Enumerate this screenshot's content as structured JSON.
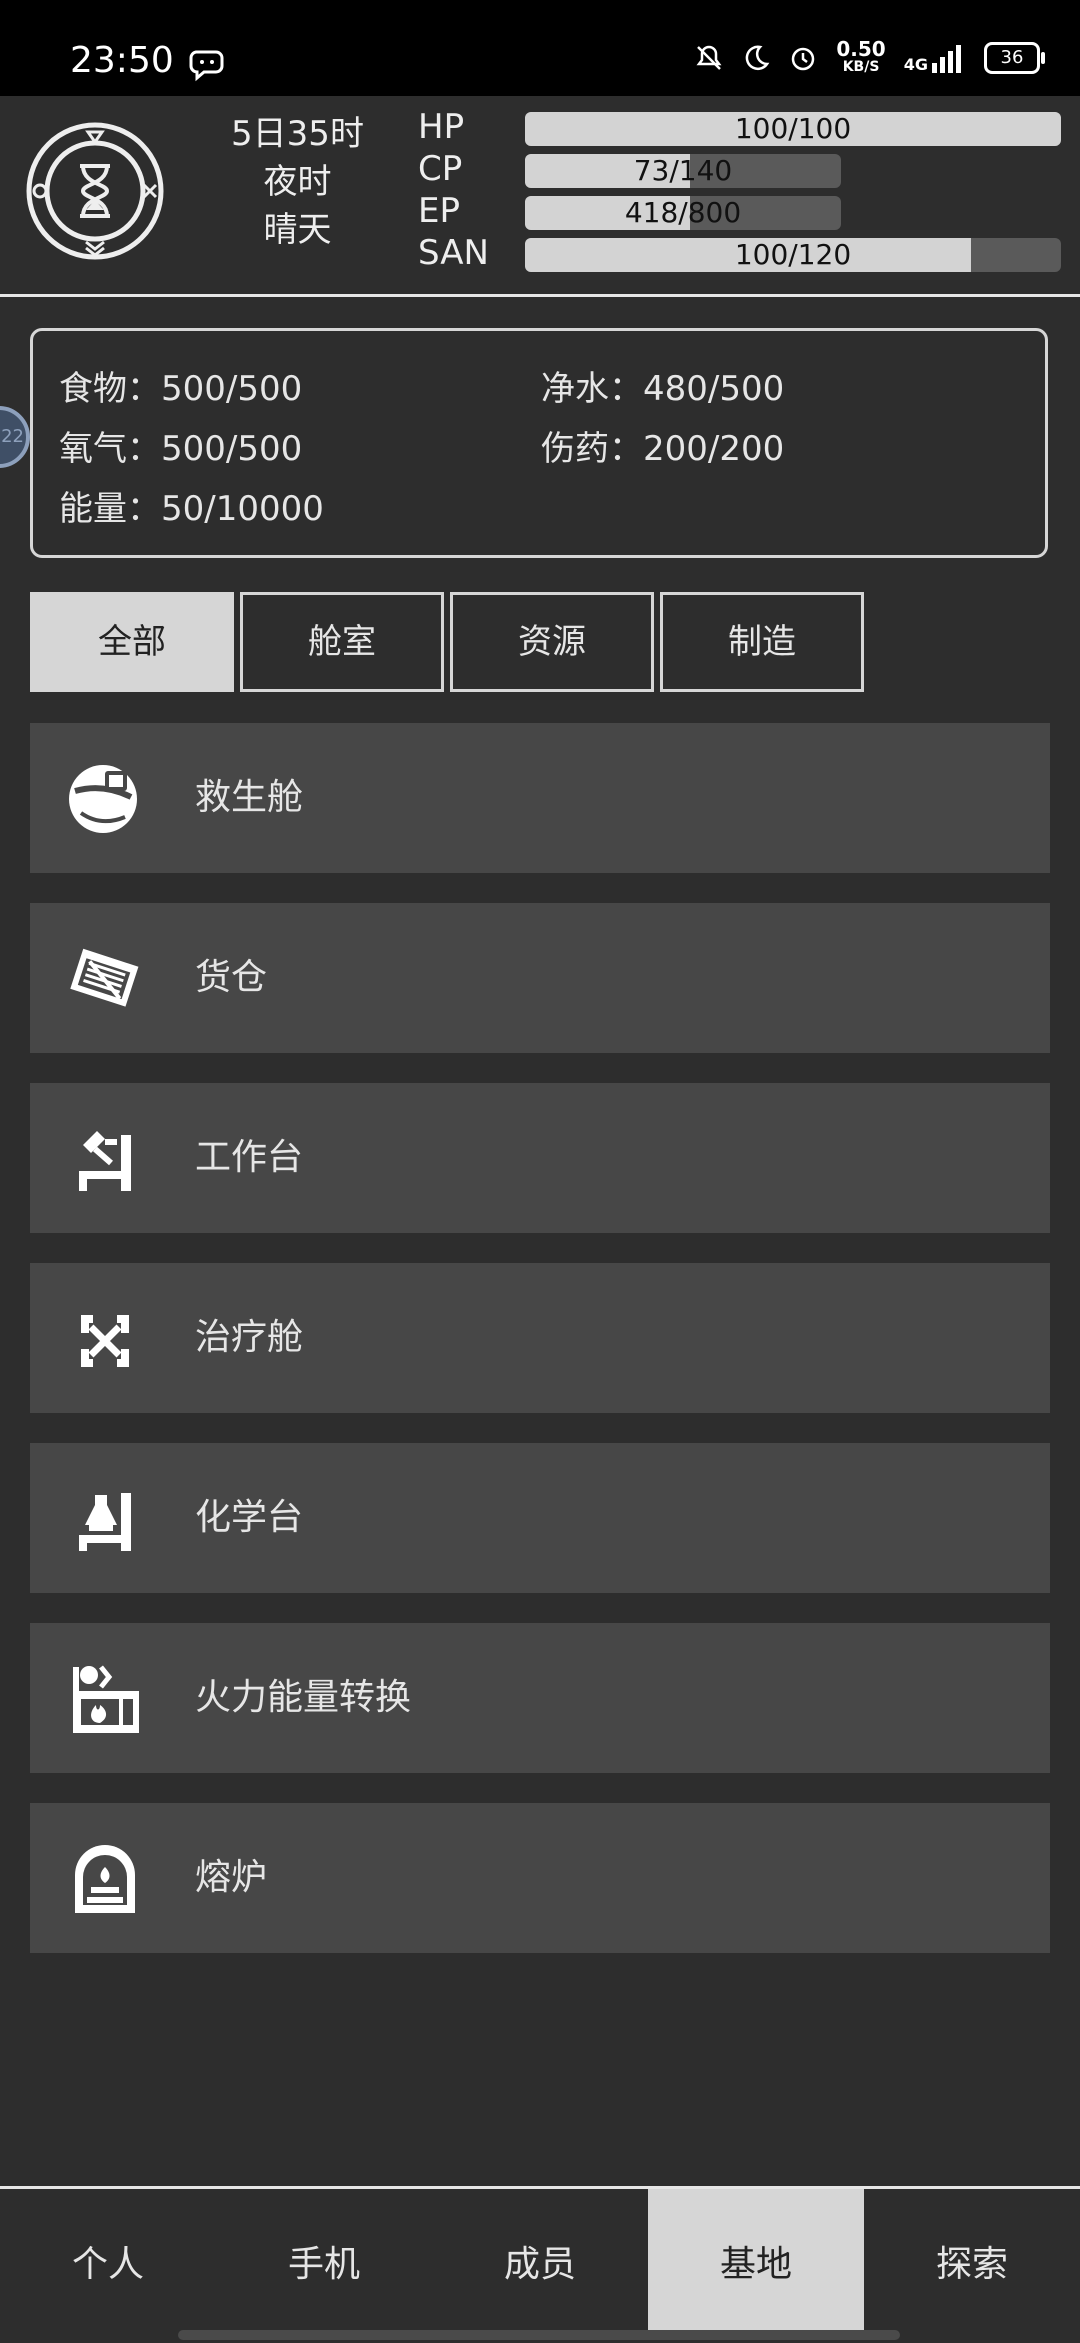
{
  "statusbar": {
    "time": "23:50",
    "speed_value": "0.50",
    "speed_unit": "KB/S",
    "network": "4G",
    "battery": "36"
  },
  "game": {
    "date": "5日35时",
    "period": "夜时",
    "weather": "晴天",
    "stats": [
      {
        "label": "HP",
        "text": "100/100",
        "fill": 1.0
      },
      {
        "label": "CP",
        "text": "73/140",
        "fill": 0.521
      },
      {
        "label": "EP",
        "text": "418/800",
        "fill": 0.5225
      },
      {
        "label": "SAN",
        "text": "100/120",
        "fill": 0.833
      }
    ]
  },
  "resources": [
    {
      "text": "食物：500/500"
    },
    {
      "text": "净水：480/500"
    },
    {
      "text": "氧气：500/500"
    },
    {
      "text": "伤药：200/200"
    },
    {
      "text": "能量：50/10000"
    }
  ],
  "floating_badge": "22",
  "tabs": [
    {
      "label": "全部",
      "active": true
    },
    {
      "label": "舱室",
      "active": false
    },
    {
      "label": "资源",
      "active": false
    },
    {
      "label": "制造",
      "active": false
    }
  ],
  "facilities": [
    {
      "label": "救生舱",
      "icon": "pod-icon"
    },
    {
      "label": "货仓",
      "icon": "cargo-icon"
    },
    {
      "label": "工作台",
      "icon": "workbench-icon"
    },
    {
      "label": "治疗舱",
      "icon": "treatment-icon"
    },
    {
      "label": "化学台",
      "icon": "chemistry-icon"
    },
    {
      "label": "火力能量转换",
      "icon": "fire-energy-icon"
    },
    {
      "label": "熔炉",
      "icon": "furnace-icon"
    }
  ],
  "nav": [
    {
      "label": "个人",
      "active": false
    },
    {
      "label": "手机",
      "active": false
    },
    {
      "label": "成员",
      "active": false
    },
    {
      "label": "基地",
      "active": true
    },
    {
      "label": "探索",
      "active": false
    }
  ]
}
